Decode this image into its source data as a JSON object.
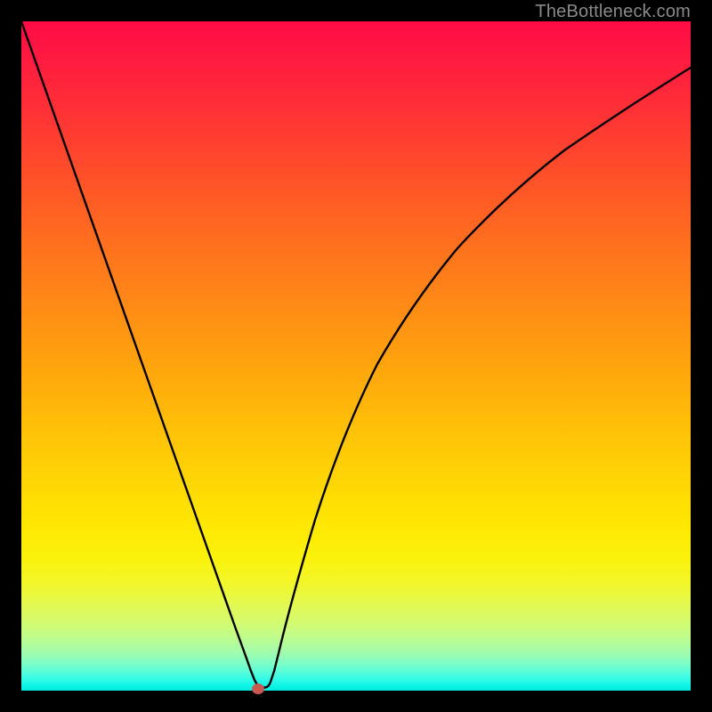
{
  "watermark": {
    "text": "TheBottleneck.com"
  },
  "colors": {
    "curve_stroke": "#000000",
    "dot_fill": "#c95850",
    "frame": "#000000"
  },
  "dot_position": {
    "x_frac": 0.353,
    "y_frac": 0.997
  },
  "chart_data": {
    "type": "line",
    "title": "",
    "xlabel": "",
    "ylabel": "",
    "xlim": [
      0,
      1
    ],
    "ylim": [
      0,
      1
    ],
    "note": "Axes are unlabeled in the source image. Coordinates below are normalized fractions of the plot area (0 = top/left, 1 = bottom/right for x/y respectively converted so y is value from bottom). Values here use y measured from bottom (0 = bottom, 1 = top) as is conventional for chart data.",
    "series": [
      {
        "name": "curve",
        "x": [
          0.0,
          0.05,
          0.1,
          0.15,
          0.2,
          0.25,
          0.3,
          0.325,
          0.345,
          0.36,
          0.38,
          0.4,
          0.425,
          0.45,
          0.5,
          0.55,
          0.6,
          0.65,
          0.7,
          0.75,
          0.8,
          0.85,
          0.9,
          0.95,
          1.0
        ],
        "y": [
          1.0,
          0.86,
          0.72,
          0.575,
          0.43,
          0.285,
          0.135,
          0.06,
          0.01,
          0.005,
          0.02,
          0.08,
          0.19,
          0.29,
          0.44,
          0.555,
          0.645,
          0.715,
          0.77,
          0.815,
          0.85,
          0.88,
          0.905,
          0.92,
          0.935
        ]
      }
    ],
    "markers": [
      {
        "name": "min-dot",
        "x": 0.353,
        "y": 0.003
      }
    ],
    "background_gradient": {
      "orientation": "vertical",
      "stops": [
        {
          "pos": 0.0,
          "color": "#ff0b45"
        },
        {
          "pos": 0.25,
          "color": "#ff5627"
        },
        {
          "pos": 0.5,
          "color": "#ffa60d"
        },
        {
          "pos": 0.75,
          "color": "#ffe703"
        },
        {
          "pos": 0.9,
          "color": "#d2fb72"
        },
        {
          "pos": 1.0,
          "color": "#00eadc"
        }
      ]
    }
  }
}
